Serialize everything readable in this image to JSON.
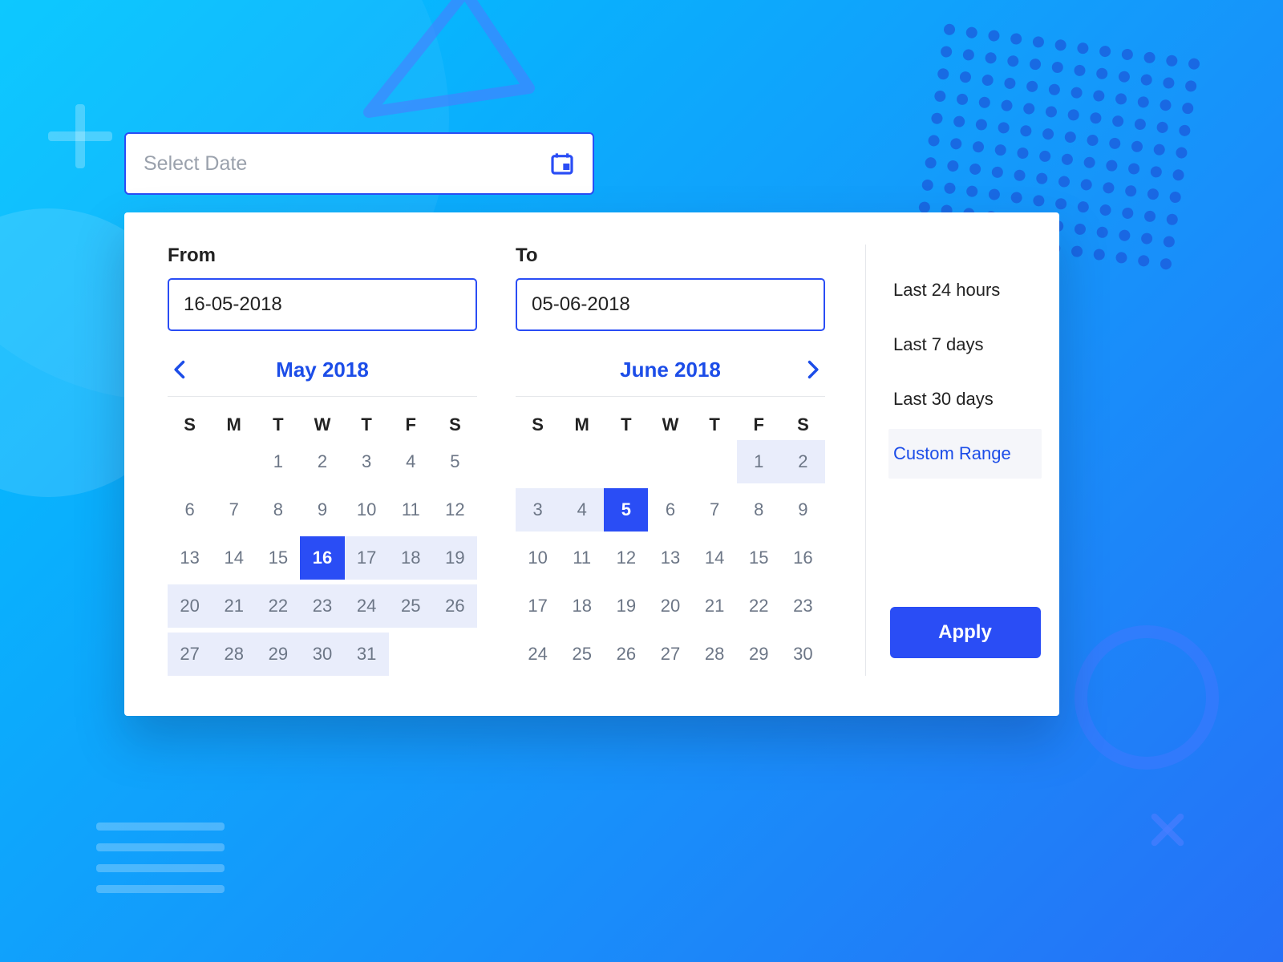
{
  "select": {
    "placeholder": "Select Date"
  },
  "from": {
    "label": "From",
    "value": "16-05-2018"
  },
  "to": {
    "label": "To",
    "value": "05-06-2018"
  },
  "calendars": {
    "left": {
      "title": "May 2018",
      "selectedDay": 16,
      "rangeDays": [
        17,
        18,
        19,
        20,
        21,
        22,
        23,
        24,
        25,
        26,
        27,
        28,
        29,
        30,
        31
      ],
      "startWeekday": 2,
      "daysInMonth": 31
    },
    "right": {
      "title": "June 2018",
      "selectedDay": 5,
      "rangeDays": [
        1,
        2,
        3,
        4
      ],
      "startWeekday": 5,
      "daysInMonth": 30
    },
    "dow": [
      "S",
      "M",
      "T",
      "W",
      "T",
      "F",
      "S"
    ]
  },
  "presets": [
    {
      "label": "Last 24 hours",
      "active": false
    },
    {
      "label": "Last 7 days",
      "active": false
    },
    {
      "label": "Last 30 days",
      "active": false
    },
    {
      "label": "Custom Range",
      "active": true
    }
  ],
  "applyLabel": "Apply"
}
